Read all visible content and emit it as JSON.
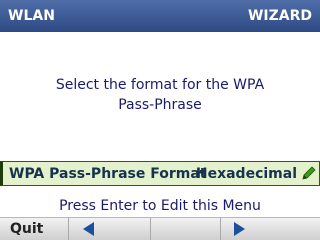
{
  "title_bar": {
    "left_title": "WLAN",
    "right_title": "WIZARD"
  },
  "prompt": {
    "line1": "Select the format for the WPA",
    "line2": "Pass-Phrase"
  },
  "setting": {
    "label": "WPA Pass-Phrase Format",
    "value": "Hexadecimal",
    "icon": "pencil-icon"
  },
  "hint": "Press Enter to Edit this Menu",
  "soft_keys": {
    "quit_label": "Quit",
    "left_icon": "left-arrow-icon",
    "right_icon": "right-arrow-icon"
  },
  "colors": {
    "title_bar": "#3b5998",
    "text_blue": "#1a1a6e",
    "setting_bg": "#e3f2cc",
    "pencil": "#3a9a1a"
  }
}
